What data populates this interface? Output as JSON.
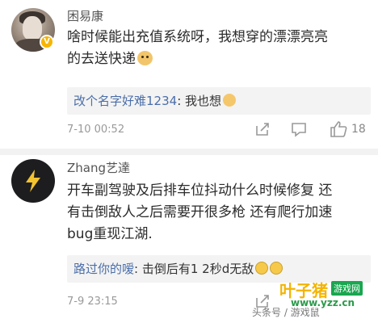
{
  "comments": [
    {
      "username": "困易康",
      "lines": [
        "啥时候能出充值系统呀，我想穿的漂漂亮亮",
        "的去送快递"
      ],
      "emoji": "doge-emoji",
      "reply": {
        "user": "改个名字好难1234",
        "sep": ": ",
        "text": "我也想"
      },
      "date": "7-10 00:52",
      "likes": "18",
      "verified": "V"
    },
    {
      "username": "Zhang艺達",
      "lines": [
        "开车副驾驶及后排车位抖动什么时候修复 还",
        "有击倒敌人之后需要开很多枪 还有爬行加速",
        "bug重现江湖."
      ],
      "reply": {
        "user": "路过你的嗳",
        "sep": ": ",
        "text": "击倒后有1 2秒d无敌"
      },
      "date": "7-9 23:15"
    }
  ],
  "watermark": {
    "title": "叶子猪",
    "tag": "游戏网",
    "url": "www.yzz.cn",
    "caption": "头条号 / 游戏鼠"
  },
  "colors": {
    "link": "#4a6ea9",
    "muted": "#999999",
    "badge": "#f7b500"
  }
}
